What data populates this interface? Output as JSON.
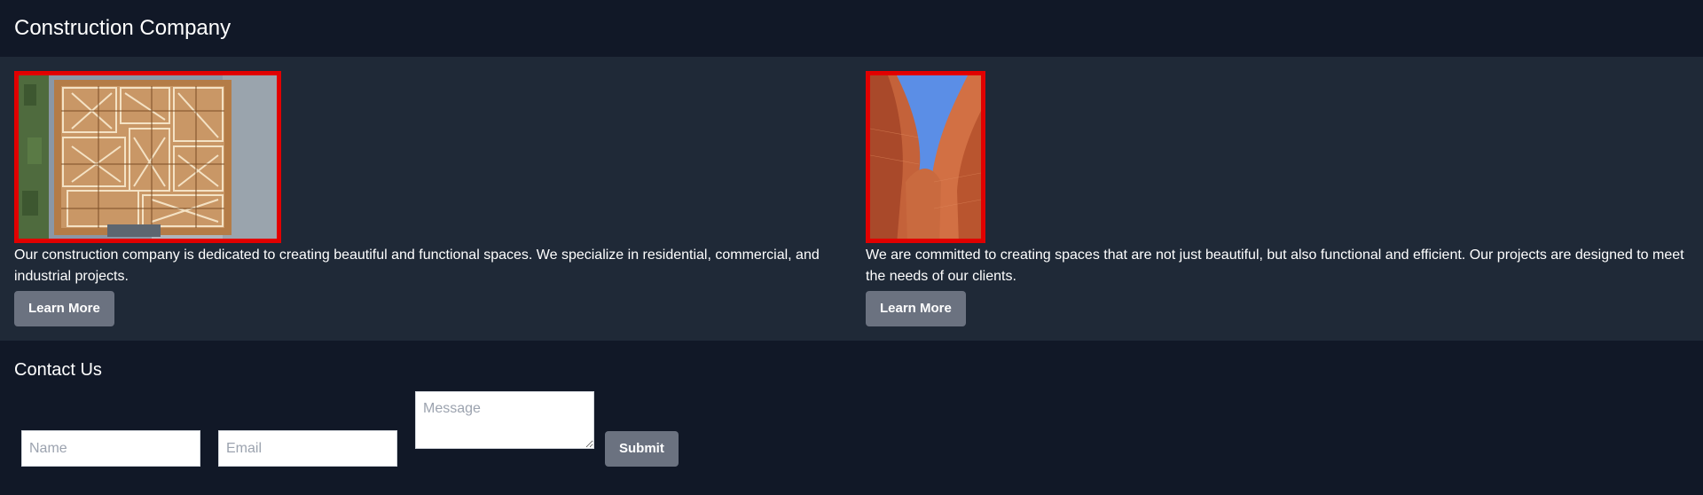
{
  "header": {
    "title": "Construction Company"
  },
  "projects": [
    {
      "image_icon": "framing-aerial-image",
      "description": "Our construction company is dedicated to creating beautiful and functional spaces. We specialize in residential, commercial, and industrial projects.",
      "button_label": "Learn More"
    },
    {
      "image_icon": "curved-architecture-image",
      "description": "We are committed to creating spaces that are not just beautiful, but also functional and efficient. Our projects are designed to meet the needs of our clients.",
      "button_label": "Learn More"
    }
  ],
  "contact": {
    "title": "Contact Us",
    "name_placeholder": "Name",
    "email_placeholder": "Email",
    "message_placeholder": "Message",
    "submit_label": "Submit"
  },
  "colors": {
    "page_bg": "#111827",
    "section_bg": "#1f2937",
    "button_bg": "#6b7280",
    "image_border": "#e10000"
  }
}
